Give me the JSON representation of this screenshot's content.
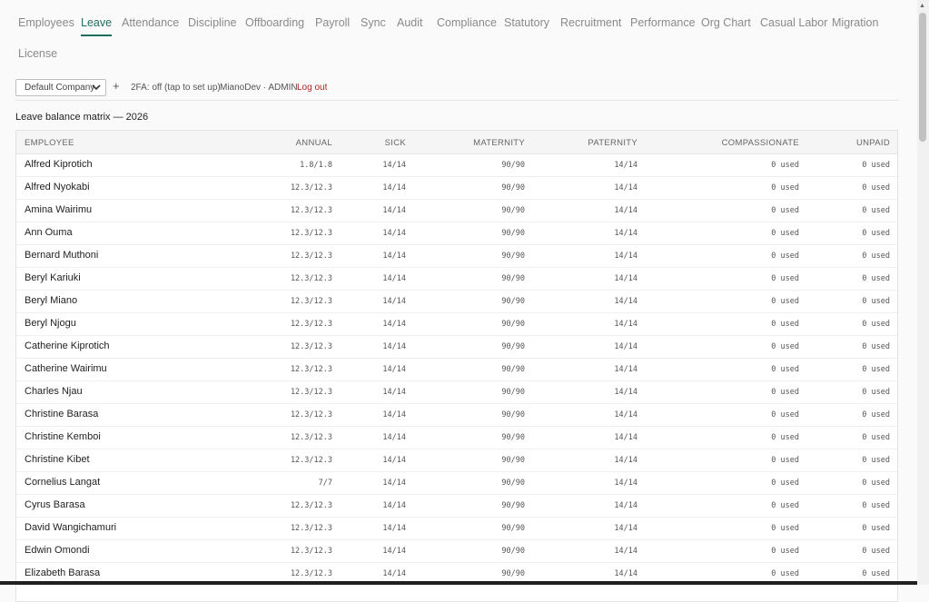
{
  "nav": {
    "tabs": [
      {
        "label": "Employees"
      },
      {
        "label": "Leave",
        "active": true
      },
      {
        "label": "Attendance"
      },
      {
        "label": "Discipline"
      },
      {
        "label": "Offboarding"
      },
      {
        "label": "Payroll"
      },
      {
        "label": "Sync"
      },
      {
        "label": "Audit"
      },
      {
        "label": "Compliance"
      },
      {
        "label": "Statutory"
      },
      {
        "label": "Recruitment"
      },
      {
        "label": "Performance"
      },
      {
        "label": "Org Chart"
      },
      {
        "label": "Casual Labor"
      },
      {
        "label": "Migration"
      },
      {
        "label": "License"
      }
    ]
  },
  "toolbar": {
    "company_selected": "Default Company",
    "add_symbol": "+",
    "twofa_status": "2FA: off (tap to set up)",
    "user": "MianoDev · ADMIN",
    "logout": "Log out"
  },
  "section_title": "Leave balance matrix — 2026",
  "table": {
    "columns": [
      "EMPLOYEE",
      "ANNUAL",
      "SICK",
      "MATERNITY",
      "PATERNITY",
      "COMPASSIONATE",
      "UNPAID"
    ],
    "rows": [
      [
        "Alfred Kiprotich",
        "1.8/1.8",
        "14/14",
        "90/90",
        "14/14",
        "0 used",
        "0 used"
      ],
      [
        "Alfred Nyokabi",
        "12.3/12.3",
        "14/14",
        "90/90",
        "14/14",
        "0 used",
        "0 used"
      ],
      [
        "Amina Wairimu",
        "12.3/12.3",
        "14/14",
        "90/90",
        "14/14",
        "0 used",
        "0 used"
      ],
      [
        "Ann Ouma",
        "12.3/12.3",
        "14/14",
        "90/90",
        "14/14",
        "0 used",
        "0 used"
      ],
      [
        "Bernard Muthoni",
        "12.3/12.3",
        "14/14",
        "90/90",
        "14/14",
        "0 used",
        "0 used"
      ],
      [
        "Beryl Kariuki",
        "12.3/12.3",
        "14/14",
        "90/90",
        "14/14",
        "0 used",
        "0 used"
      ],
      [
        "Beryl Miano",
        "12.3/12.3",
        "14/14",
        "90/90",
        "14/14",
        "0 used",
        "0 used"
      ],
      [
        "Beryl Njogu",
        "12.3/12.3",
        "14/14",
        "90/90",
        "14/14",
        "0 used",
        "0 used"
      ],
      [
        "Catherine Kiprotich",
        "12.3/12.3",
        "14/14",
        "90/90",
        "14/14",
        "0 used",
        "0 used"
      ],
      [
        "Catherine Wairimu",
        "12.3/12.3",
        "14/14",
        "90/90",
        "14/14",
        "0 used",
        "0 used"
      ],
      [
        "Charles Njau",
        "12.3/12.3",
        "14/14",
        "90/90",
        "14/14",
        "0 used",
        "0 used"
      ],
      [
        "Christine Barasa",
        "12.3/12.3",
        "14/14",
        "90/90",
        "14/14",
        "0 used",
        "0 used"
      ],
      [
        "Christine Kemboi",
        "12.3/12.3",
        "14/14",
        "90/90",
        "14/14",
        "0 used",
        "0 used"
      ],
      [
        "Christine Kibet",
        "12.3/12.3",
        "14/14",
        "90/90",
        "14/14",
        "0 used",
        "0 used"
      ],
      [
        "Cornelius Langat",
        "7/7",
        "14/14",
        "90/90",
        "14/14",
        "0 used",
        "0 used"
      ],
      [
        "Cyrus Barasa",
        "12.3/12.3",
        "14/14",
        "90/90",
        "14/14",
        "0 used",
        "0 used"
      ],
      [
        "David Wangichamuri",
        "12.3/12.3",
        "14/14",
        "90/90",
        "14/14",
        "0 used",
        "0 used"
      ],
      [
        "Edwin Omondi",
        "12.3/12.3",
        "14/14",
        "90/90",
        "14/14",
        "0 used",
        "0 used"
      ],
      [
        "Elizabeth Barasa",
        "12.3/12.3",
        "14/14",
        "90/90",
        "14/14",
        "0 used",
        "0 used"
      ]
    ]
  },
  "colors": {
    "accent": "#1f6f5c",
    "logout": "#b22222",
    "tab_inactive": "#8a8a8a"
  }
}
